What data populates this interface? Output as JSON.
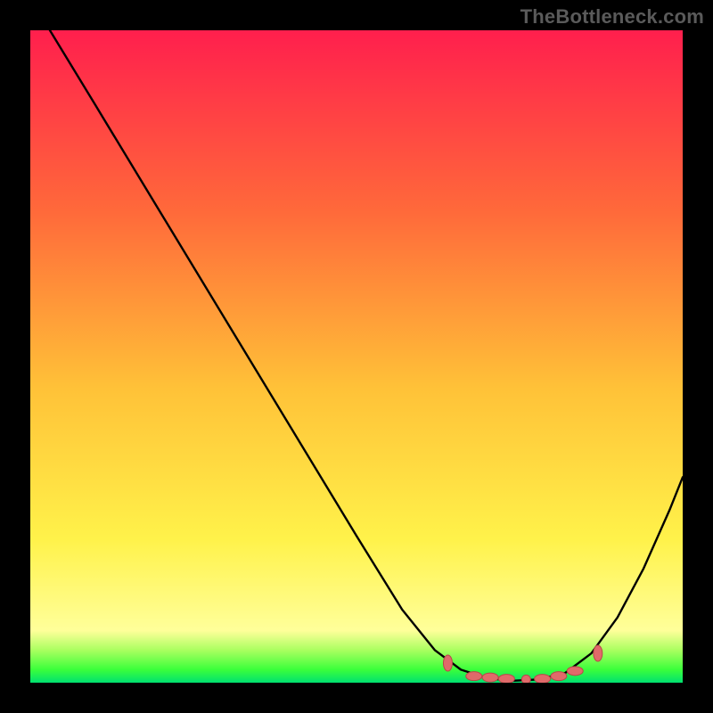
{
  "watermark": "TheBottleneck.com",
  "colors": {
    "bg_black": "#000000",
    "grad_top": "#ff1f4d",
    "grad_mid1": "#ff6a3a",
    "grad_mid2": "#ffc238",
    "grad_mid3": "#fff24a",
    "grad_bottom": "#ffff9a",
    "green_top": "#aaff60",
    "green_mid": "#3bff3b",
    "green_bot": "#00e070",
    "curve": "#000000",
    "marker_fill": "#e06a6a",
    "marker_stroke": "#b84848"
  },
  "chart_data": {
    "type": "line",
    "title": "",
    "xlabel": "",
    "ylabel": "",
    "xlim": [
      0,
      1
    ],
    "ylim": [
      0,
      1
    ],
    "curve": {
      "name": "bottleneck-curve",
      "points": [
        [
          0.0,
          1.08
        ],
        [
          0.03,
          1.0
        ],
        [
          0.1,
          0.885
        ],
        [
          0.2,
          0.72
        ],
        [
          0.3,
          0.555
        ],
        [
          0.4,
          0.39
        ],
        [
          0.5,
          0.225
        ],
        [
          0.57,
          0.112
        ],
        [
          0.62,
          0.05
        ],
        [
          0.66,
          0.02
        ],
        [
          0.7,
          0.007
        ],
        [
          0.74,
          0.003
        ],
        [
          0.78,
          0.005
        ],
        [
          0.82,
          0.015
        ],
        [
          0.86,
          0.045
        ],
        [
          0.9,
          0.1
        ],
        [
          0.94,
          0.175
        ],
        [
          0.98,
          0.265
        ],
        [
          1.0,
          0.315
        ]
      ]
    },
    "markers": [
      {
        "x": 0.64,
        "y": 0.03,
        "shape": "vbar"
      },
      {
        "x": 0.68,
        "y": 0.01,
        "shape": "hbar"
      },
      {
        "x": 0.705,
        "y": 0.008,
        "shape": "hbar"
      },
      {
        "x": 0.73,
        "y": 0.006,
        "shape": "hbar"
      },
      {
        "x": 0.76,
        "y": 0.005,
        "shape": "dot"
      },
      {
        "x": 0.785,
        "y": 0.006,
        "shape": "hbar"
      },
      {
        "x": 0.81,
        "y": 0.01,
        "shape": "hbar"
      },
      {
        "x": 0.835,
        "y": 0.018,
        "shape": "hbar"
      },
      {
        "x": 0.87,
        "y": 0.045,
        "shape": "vbar"
      }
    ]
  }
}
